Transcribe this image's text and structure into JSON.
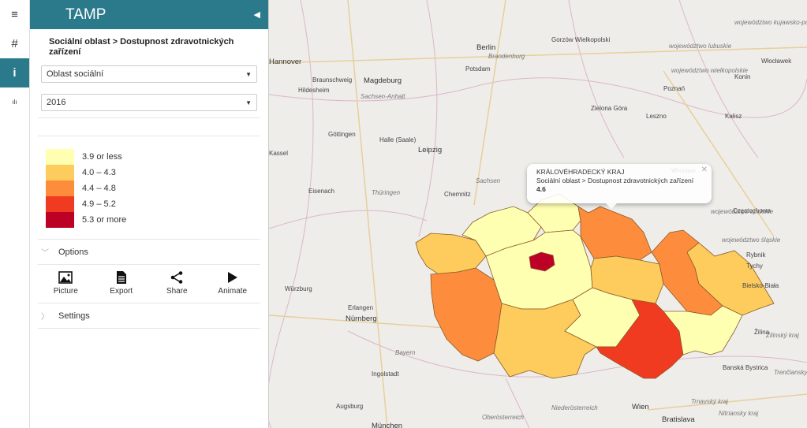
{
  "app": {
    "title": "TAMP"
  },
  "rail": {
    "items": [
      {
        "icon": "menu-icon",
        "glyph": "≡"
      },
      {
        "icon": "hash-icon",
        "glyph": "#"
      },
      {
        "icon": "info-icon",
        "glyph": "i"
      },
      {
        "icon": "chart-icon",
        "glyph": "ılı"
      }
    ]
  },
  "panel": {
    "breadcrumb": "Sociální oblast > Dostupnost zdravotnických zařízení",
    "area_select": "Oblast sociální",
    "year_select": "2016",
    "legend": [
      {
        "label": "3.9 or less",
        "color": "#ffffb2"
      },
      {
        "label": "4.0 – 4.3",
        "color": "#fecc5c"
      },
      {
        "label": "4.4 – 4.8",
        "color": "#fd8d3c"
      },
      {
        "label": "4.9 – 5.2",
        "color": "#f03b20"
      },
      {
        "label": "5.3 or more",
        "color": "#bd0026"
      }
    ],
    "options_label": "Options",
    "tools": {
      "picture": "Picture",
      "export": "Export",
      "share": "Share",
      "animate": "Animate"
    },
    "settings_label": "Settings"
  },
  "popup": {
    "region": "KRÁLOVÉHRADECKÝ KRAJ",
    "indicator": "Sociální oblast > Dostupnost zdravotnických zařízení",
    "value": "4.6"
  },
  "map": {
    "accent": "#2a7a8c",
    "cities": [
      "Hannover",
      "Braunschweig",
      "Magdeburg",
      "Hildesheim",
      "Sachsen-Anhalt",
      "Berlin",
      "Brandenburg",
      "Potsdam",
      "Gorzów Wielkopolski",
      "województwo lubuskie",
      "województwo wielkopolskie",
      "Poznań",
      "Konin",
      "Włocławek",
      "województwo kujawsko-pomorskie",
      "Zielona Góra",
      "Leszno",
      "Kalisz",
      "Göttingen",
      "Halle (Saale)",
      "Leipzig",
      "Kassel",
      "Sachsen",
      "Eisenach",
      "Thüringen",
      "Chemnitz",
      "Wrocław",
      "Częstochowa",
      "województwo opolskie",
      "województwo śląskie",
      "Rybnik",
      "Tychy",
      "Bielsko-Biała",
      "Würzburg",
      "Erlangen",
      "Nürnberg",
      "Bayern",
      "Ingolstadt",
      "Augsburg",
      "München",
      "Oberösterreich",
      "Niederösterreich",
      "Wien",
      "Bratislava",
      "Trnavský kraj",
      "Nitriansky kraj",
      "Banská Bystrica",
      "Žilina",
      "Žilinský kraj",
      "Trenčiansky kraj"
    ]
  }
}
